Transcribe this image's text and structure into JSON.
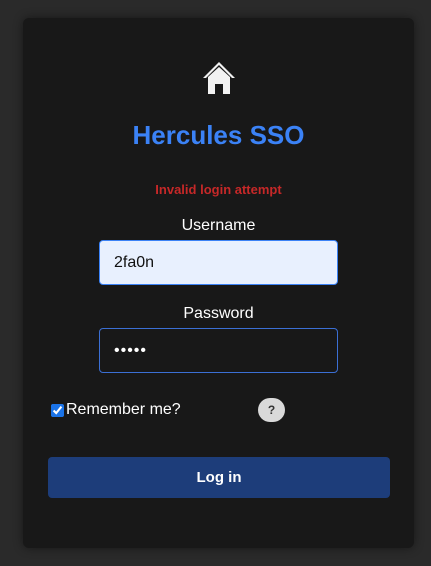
{
  "app": {
    "title": "Hercules SSO",
    "icon": "home-icon"
  },
  "error": {
    "message": "Invalid login attempt",
    "color": "#c62828"
  },
  "form": {
    "username_label": "Username",
    "username_value": "2fa0n",
    "password_label": "Password",
    "password_value": "•••••",
    "remember_label": "Remember me?",
    "remember_checked": true,
    "help_label": "?",
    "submit_label": "Log in"
  },
  "colors": {
    "accent": "#3b82f6",
    "button": "#1d3d7a",
    "background": "#2a2a2a",
    "card": "#181818"
  }
}
